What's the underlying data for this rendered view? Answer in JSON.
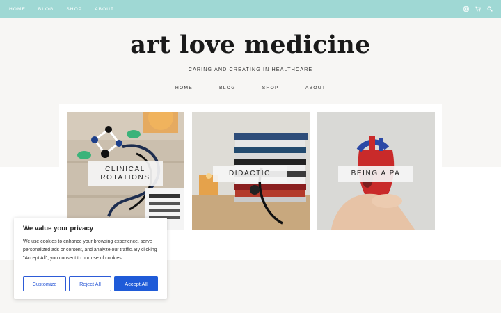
{
  "topnav": {
    "items": [
      "HOME",
      "BLOG",
      "SHOP",
      "ABOUT"
    ]
  },
  "topicons": [
    "instagram-icon",
    "cart-icon",
    "search-icon"
  ],
  "site": {
    "title": "art love medicine",
    "tagline": "CARING AND CREATING IN HEALTHCARE"
  },
  "mainnav": {
    "items": [
      "HOME",
      "BLOG",
      "SHOP",
      "ABOUT"
    ]
  },
  "cards": [
    {
      "label_line1": "CLINICAL",
      "label_line2": "ROTATIONS"
    },
    {
      "label": "DIDACTIC"
    },
    {
      "label": "BEING A PA"
    }
  ],
  "cookie": {
    "title": "We value your privacy",
    "body": "We use cookies to enhance your browsing experience, serve personalized ads or content, and analyze our traffic. By clicking \"Accept All\", you consent to our use of cookies.",
    "customize": "Customize",
    "reject": "Reject All",
    "accept": "Accept All"
  },
  "colors": {
    "topbar": "#9fd8d4",
    "accent": "#1f5bd8"
  }
}
